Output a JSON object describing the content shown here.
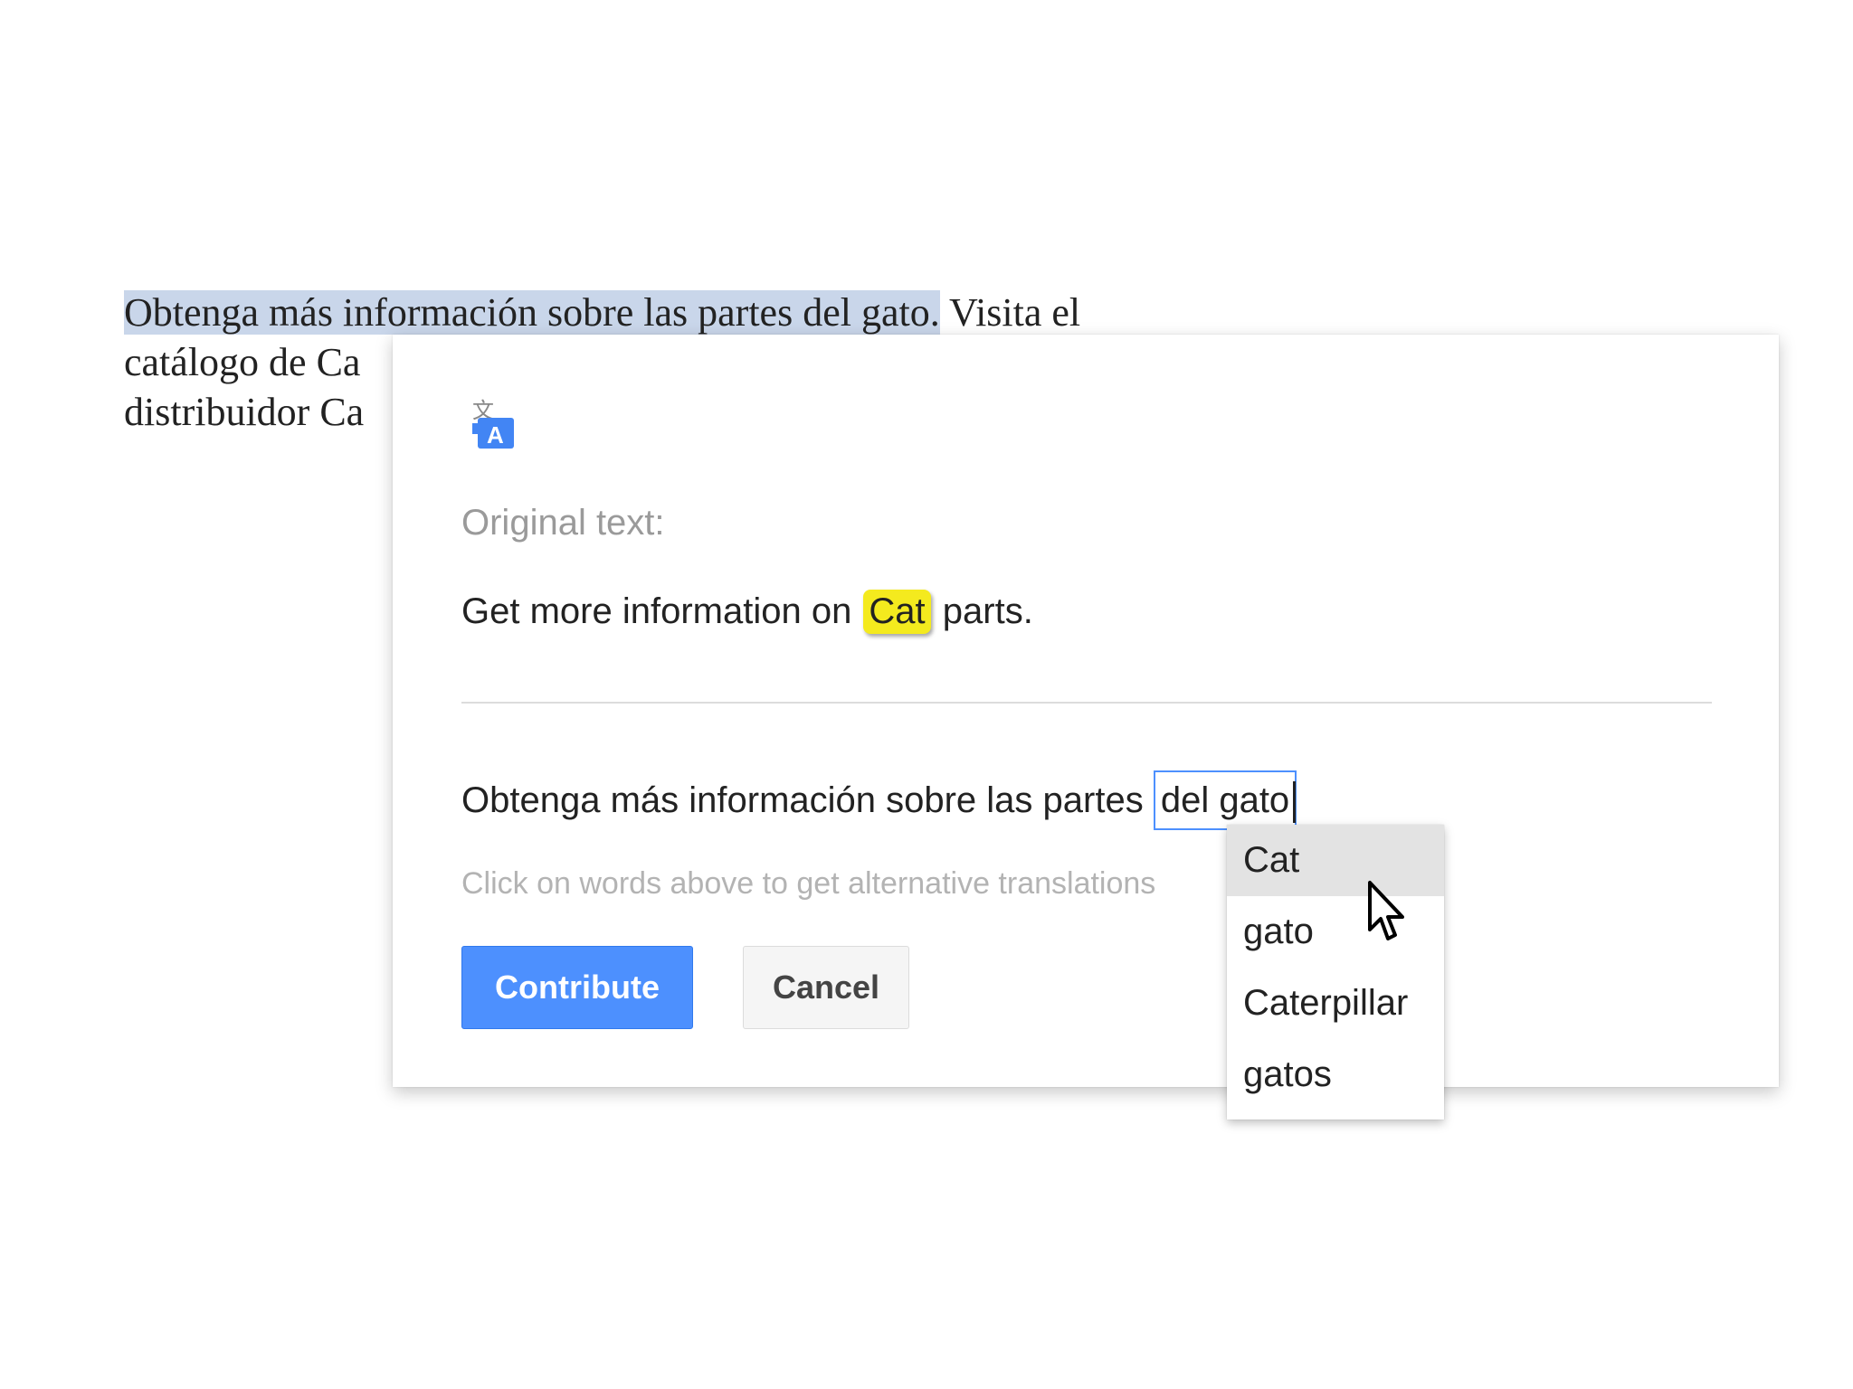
{
  "background_text": {
    "line1_selected": "Obtenga más información sobre las partes del gato.",
    "line1_rest": " Visita el",
    "line2": "catálogo de Ca",
    "line3": "distribuidor Ca"
  },
  "dialog": {
    "icon": "google-translate-icon",
    "original_label": "Original text:",
    "original": {
      "before": "Get more information on ",
      "highlight": "Cat",
      "after": " parts."
    },
    "translation": {
      "before": "Obtenga más información sobre las partes ",
      "selected": "del gato"
    },
    "hint": "Click on words above to get alternative translations",
    "contribute_label": "Contribute",
    "cancel_label": "Cancel"
  },
  "alternatives": {
    "items": [
      "Cat",
      "gato",
      "Caterpillar",
      "gatos"
    ],
    "hovered": "Cat"
  },
  "colors": {
    "contribute_bg": "#4d90fe",
    "highlight": "#f4ea1e",
    "selection": "#c9d6ea"
  }
}
